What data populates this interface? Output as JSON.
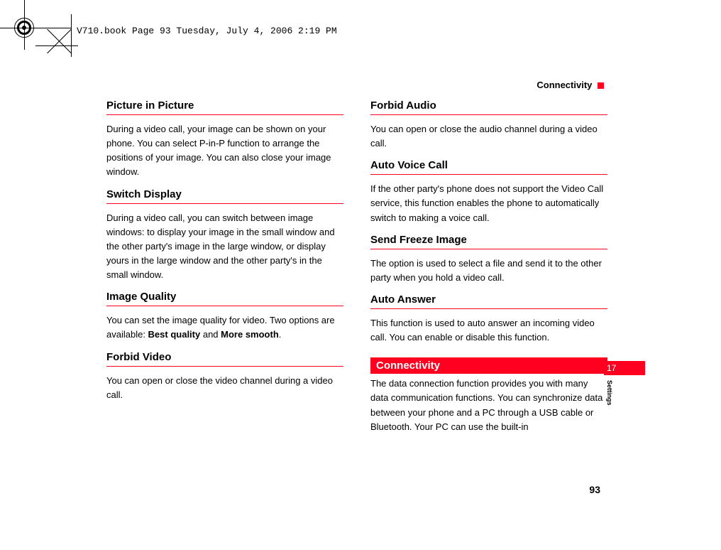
{
  "annotation": "V710.book  Page 93  Tuesday, July 4, 2006  2:19 PM",
  "running_head": "Connectivity",
  "left_col": {
    "h1": "Picture in Picture",
    "p1": "During a video call, your image can be shown on your phone. You can select P-in-P function to arrange the positions of your image. You can also close your image window.",
    "h2": "Switch Display",
    "p2": "During a video call, you can switch between image windows: to display your image in the small window and the other party's image in the large window, or display yours in the large window and the other party's in the small window.",
    "h3": "Image Quality",
    "p3a": "You can set the image quality for video. Two options are available: ",
    "p3b1": "Best quality",
    "p3b_and": " and ",
    "p3b2": "More smooth",
    "p3c": ".",
    "h4": "Forbid Video",
    "p4": "You can open or close the video channel during a video call."
  },
  "right_col": {
    "h1": "Forbid Audio",
    "p1": "You can open or close the audio channel during a video call.",
    "h2": "Auto Voice Call",
    "p2": "If the other party's phone does not support the Video Call service, this function enables the phone to automatically switch to making a voice call.",
    "h3": "Send Freeze Image",
    "p3": "The option is used to select a file and send it to the other party when you hold a video call.",
    "h4": "Auto Answer",
    "p4": "This function is used to auto answer an incoming video call. You can enable or disable this function.",
    "section": "Connectivity",
    "p5": "The data connection function provides you with many data communication functions. You can synchronize data between your phone and a PC through a USB cable or Bluetooth. Your PC can use the built-in"
  },
  "side_tab_num": "17",
  "side_label": "Settings",
  "page_number": "93"
}
